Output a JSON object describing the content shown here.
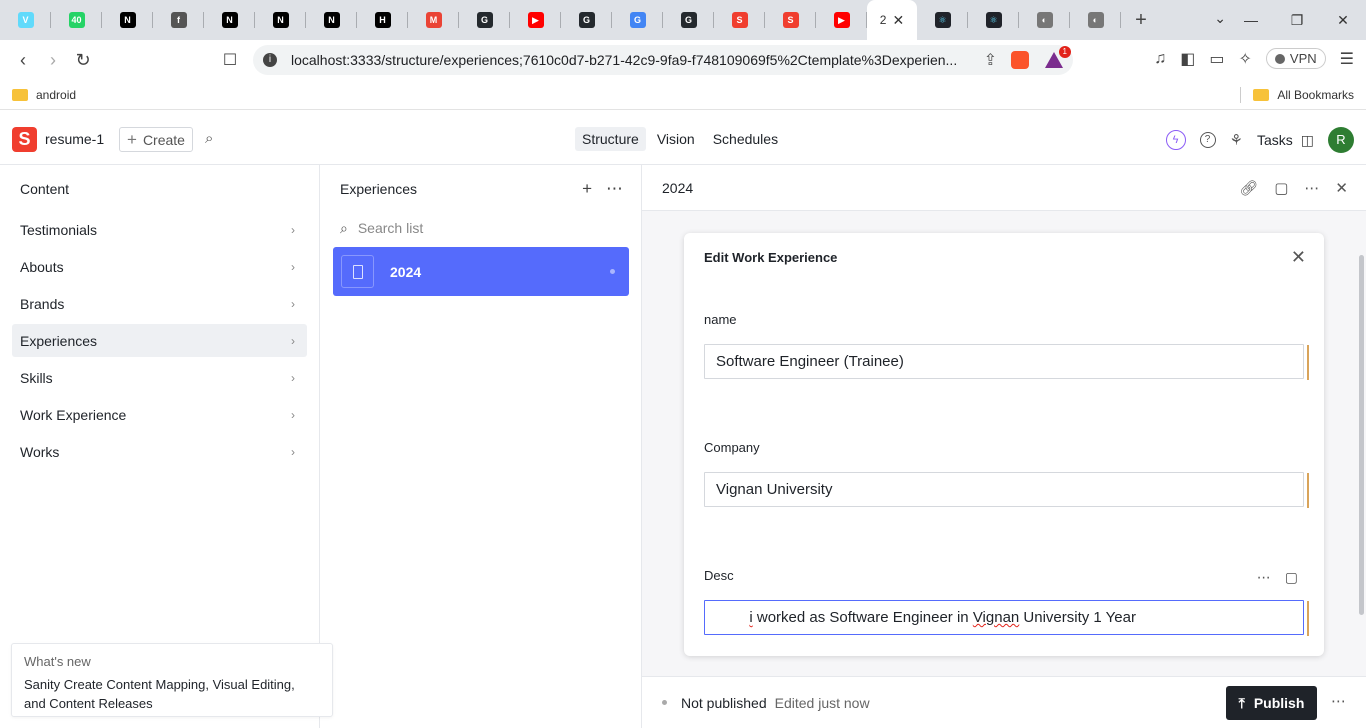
{
  "browser": {
    "tabs": [
      {
        "icon": "react-icon",
        "color": "#61dafb",
        "letter": "V"
      },
      {
        "icon": "whatsapp-icon",
        "color": "#25d366",
        "letter": "40"
      },
      {
        "icon": "nextjs-icon",
        "color": "#000000",
        "letter": "N"
      },
      {
        "icon": "globe-icon",
        "color": "#555555",
        "letter": "f"
      },
      {
        "icon": "nextjs-icon",
        "color": "#000000",
        "letter": "N"
      },
      {
        "icon": "nextjs-icon",
        "color": "#000000",
        "letter": "N"
      },
      {
        "icon": "nextjs-icon",
        "color": "#000000",
        "letter": "N"
      },
      {
        "icon": "hackernoon-icon",
        "color": "#000000",
        "letter": "H"
      },
      {
        "icon": "gmail-icon",
        "color": "#ea4335",
        "letter": "M"
      },
      {
        "icon": "github-icon",
        "color": "#24292e",
        "letter": "G"
      },
      {
        "icon": "youtube-icon",
        "color": "#ff0000",
        "letter": "▶"
      },
      {
        "icon": "github-icon",
        "color": "#24292e",
        "letter": "G"
      },
      {
        "icon": "google-icon",
        "color": "#4285f4",
        "letter": "G"
      },
      {
        "icon": "github-icon",
        "color": "#24292e",
        "letter": "G"
      },
      {
        "icon": "sanity-icon",
        "color": "#f03e2f",
        "letter": "S"
      },
      {
        "icon": "sanity-icon",
        "color": "#f03e2f",
        "letter": "S"
      },
      {
        "icon": "youtube-icon",
        "color": "#ff0000",
        "letter": "▶"
      }
    ],
    "active_tab_title": "2",
    "url": "localhost:3333/structure/experiences;7610c0d7-b271-42c9-9fa9-f748109069f5%2Ctemplate%3Dexperien...",
    "extension_badge": "1",
    "vpn_label": "VPN",
    "bookmark_folder": "android",
    "all_bookmarks": "All Bookmarks"
  },
  "studio": {
    "project": "resume-1",
    "create_label": "Create",
    "nav": [
      "Structure",
      "Vision",
      "Schedules"
    ],
    "tasks_label": "Tasks",
    "avatar_initial": "R",
    "accent": "#556bfc",
    "brand": "#f03e2f"
  },
  "content_pane": {
    "title": "Content",
    "items": [
      "Testimonials",
      "Abouts",
      "Brands",
      "Experiences",
      "Skills",
      "Work Experience",
      "Works"
    ]
  },
  "whats_new": {
    "heading": "What's new",
    "text": "Sanity Create Content Mapping, Visual Editing, and Content Releases"
  },
  "list_pane": {
    "title": "Experiences",
    "search_placeholder": "Search list",
    "items": [
      "2024"
    ]
  },
  "document": {
    "title": "2024",
    "dialog_title": "Edit Work Experience",
    "fields": {
      "name_label": "name",
      "name_value": "Software Engineer (Trainee)",
      "company_label": "Company",
      "company_value": "Vignan University",
      "desc_label": "Desc",
      "desc_before": "i",
      "desc_mid": " worked as Software Engineer in ",
      "desc_spell": "Vignan",
      "desc_after": " University 1 Year"
    },
    "status": "Not published",
    "edited": "Edited just now",
    "publish_label": "Publish"
  }
}
